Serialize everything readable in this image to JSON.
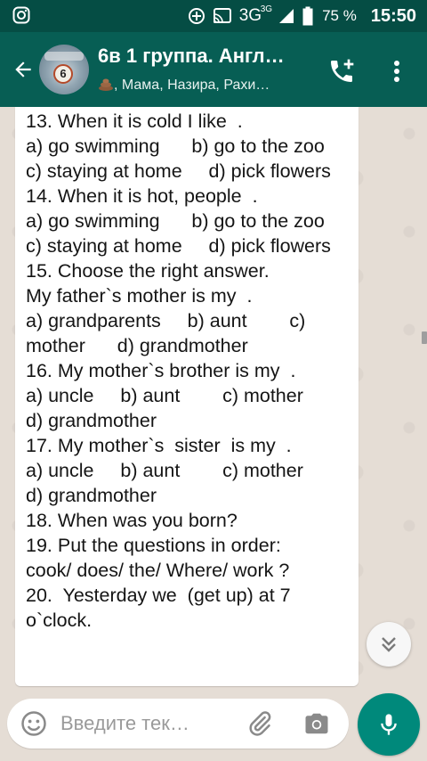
{
  "status_bar": {
    "network": "3G",
    "network_sup": "3G",
    "battery_percent": "75 %",
    "time": "15:50"
  },
  "header": {
    "title": "6в 1 группа. Англ…",
    "subtitle": ", Мама, Назира, Рахи…",
    "avatar_badge": "6"
  },
  "message": {
    "text": "13. When it is cold I like  .\na) go swimming      b) go to the zoo     c) staying at home     d) pick flowers\n14. When it is hot, people  .\na) go swimming      b) go to the zoo     c) staying at home     d) pick flowers\n15. Choose the right answer.\nMy father`s mother is my  .\na) grandparents     b) aunt        c) mother      d) grandmother\n16. My mother`s brother is my  .\na) uncle     b) aunt        c) mother\nd) grandmother\n17. My mother`s  sister  is my  .\na) uncle     b) aunt        c) mother\nd) grandmother\n18. When was you born?\n19. Put the questions in order:\ncook/ does/ the/ Where/ work ?\n20.  Yesterday we  (get up) at 7 o`clock."
  },
  "composer": {
    "placeholder": "Введите тек…"
  },
  "icons": {
    "instagram": "instagram-icon",
    "back": "arrow-back-icon",
    "call": "add-call-icon",
    "menu": "more-vert-icon",
    "emoji": "emoji-icon",
    "attach": "paperclip-icon",
    "camera": "camera-icon",
    "mic": "mic-icon",
    "scroll_down": "chevron-double-down-icon"
  },
  "colors": {
    "status_bar": "#054d44",
    "app_bar": "#075e54",
    "chat_background": "#e5ddd5",
    "mic_button": "#00897b"
  }
}
